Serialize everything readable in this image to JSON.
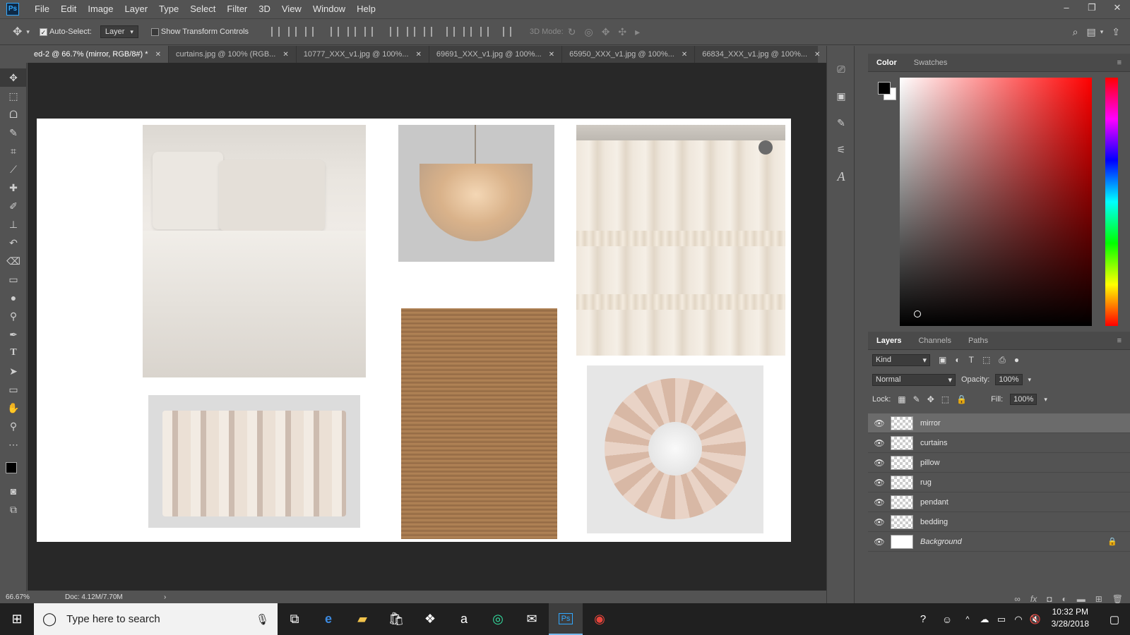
{
  "app": {
    "logo_text": "Ps"
  },
  "menu": [
    "File",
    "Edit",
    "Image",
    "Layer",
    "Type",
    "Select",
    "Filter",
    "3D",
    "View",
    "Window",
    "Help"
  ],
  "window_controls": [
    "–",
    "❐",
    "✕"
  ],
  "options": {
    "auto_select_label": "Auto-Select:",
    "auto_select_checked": true,
    "auto_select_target": "Layer",
    "show_transform_label": "Show Transform Controls",
    "show_transform_checked": false,
    "mode_3d_label": "3D Mode:"
  },
  "tabs": [
    {
      "label": "ed-2 @ 66.7% (mirror, RGB/8#) *",
      "active": true
    },
    {
      "label": "curtains.jpg @ 100% (RGB...",
      "active": false
    },
    {
      "label": "10777_XXX_v1.jpg @ 100%...",
      "active": false
    },
    {
      "label": "69691_XXX_v1.jpg @ 100%...",
      "active": false
    },
    {
      "label": "65950_XXX_v1.jpg @ 100%...",
      "active": false
    },
    {
      "label": "66834_XXX_v1.jpg @ 100%...",
      "active": false
    }
  ],
  "tools": [
    "move-tool",
    "marquee-tool",
    "lasso-tool",
    "quick-select-tool",
    "crop-tool",
    "eyedropper-tool",
    "healing-brush-tool",
    "brush-tool",
    "clone-stamp-tool",
    "history-brush-tool",
    "eraser-tool",
    "gradient-tool",
    "blur-tool",
    "dodge-tool",
    "pen-tool",
    "type-tool",
    "path-select-tool",
    "rectangle-tool",
    "hand-tool",
    "zoom-tool",
    "more-tools"
  ],
  "status": {
    "zoom": "66.67%",
    "doc": "Doc: 4.12M/7.70M"
  },
  "color_panel": {
    "tabs": [
      "Color",
      "Swatches"
    ],
    "foreground": "#000000",
    "background": "#ffffff",
    "hue": "#ff0000"
  },
  "layers_panel": {
    "tabs": [
      "Layers",
      "Channels",
      "Paths"
    ],
    "kind_label": "Kind",
    "blend_mode": "Normal",
    "opacity_label": "Opacity:",
    "opacity": "100%",
    "lock_label": "Lock:",
    "fill_label": "Fill:",
    "fill": "100%",
    "layers": [
      {
        "name": "mirror",
        "selected": true,
        "background": false
      },
      {
        "name": "curtains",
        "selected": false,
        "background": false
      },
      {
        "name": "pillow",
        "selected": false,
        "background": false
      },
      {
        "name": "rug",
        "selected": false,
        "background": false
      },
      {
        "name": "pendant",
        "selected": false,
        "background": false
      },
      {
        "name": "bedding",
        "selected": false,
        "background": false
      },
      {
        "name": "Background",
        "selected": false,
        "background": true
      }
    ]
  },
  "taskbar": {
    "search_placeholder": "Type here to search",
    "time": "10:32 PM",
    "date": "3/28/2018"
  }
}
